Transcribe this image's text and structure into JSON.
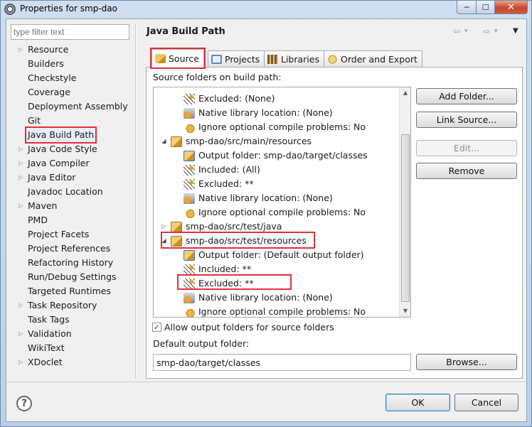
{
  "window": {
    "title": "Properties for smp-dao",
    "minimize": "─",
    "maximize": "☐",
    "close": "✕"
  },
  "filter": {
    "placeholder": "type filter text"
  },
  "nav": {
    "items": [
      {
        "label": "Resource",
        "expandable": true
      },
      {
        "label": "Builders",
        "expandable": false
      },
      {
        "label": "Checkstyle",
        "expandable": false
      },
      {
        "label": "Coverage",
        "expandable": false
      },
      {
        "label": "Deployment Assembly",
        "expandable": false
      },
      {
        "label": "Git",
        "expandable": false
      },
      {
        "label": "Java Build Path",
        "expandable": false,
        "selected": true
      },
      {
        "label": "Java Code Style",
        "expandable": true
      },
      {
        "label": "Java Compiler",
        "expandable": true
      },
      {
        "label": "Java Editor",
        "expandable": true
      },
      {
        "label": "Javadoc Location",
        "expandable": false
      },
      {
        "label": "Maven",
        "expandable": true
      },
      {
        "label": "PMD",
        "expandable": false
      },
      {
        "label": "Project Facets",
        "expandable": false
      },
      {
        "label": "Project References",
        "expandable": false
      },
      {
        "label": "Refactoring History",
        "expandable": false
      },
      {
        "label": "Run/Debug Settings",
        "expandable": false
      },
      {
        "label": "Targeted Runtimes",
        "expandable": false
      },
      {
        "label": "Task Repository",
        "expandable": true
      },
      {
        "label": "Task Tags",
        "expandable": false
      },
      {
        "label": "Validation",
        "expandable": true
      },
      {
        "label": "WikiText",
        "expandable": false
      },
      {
        "label": "XDoclet",
        "expandable": true
      }
    ]
  },
  "page": {
    "title": "Java Build Path",
    "nav_tools": {
      "back": "⇦",
      "back_menu": "▾",
      "forward": "⇨",
      "forward_menu": "▾",
      "menu": "▼"
    }
  },
  "tabs": [
    {
      "label": "Source",
      "icon": "source-folder-icon",
      "active": true
    },
    {
      "label": "Projects",
      "icon": "projects-icon",
      "active": false
    },
    {
      "label": "Libraries",
      "icon": "libraries-icon",
      "active": false
    },
    {
      "label": "Order and Export",
      "icon": "order-export-icon",
      "active": false
    }
  ],
  "source": {
    "section_label": "Source folders on build path:",
    "tree": [
      {
        "level": 1,
        "icon": "filter-icon",
        "label": "Excluded: (None)"
      },
      {
        "level": 1,
        "icon": "native-library-icon",
        "label": "Native library location: (None)"
      },
      {
        "level": 1,
        "icon": "ignore-problems-icon",
        "label": "Ignore optional compile problems: No"
      },
      {
        "level": 0,
        "icon": "source-folder-icon",
        "label": "smp-dao/src/main/resources",
        "expander": "◢"
      },
      {
        "level": 1,
        "icon": "output-folder-icon",
        "label": "Output folder: smp-dao/target/classes"
      },
      {
        "level": 1,
        "icon": "filter-icon",
        "label": "Included: (All)"
      },
      {
        "level": 1,
        "icon": "filter-icon",
        "label": "Excluded: **"
      },
      {
        "level": 1,
        "icon": "native-library-icon",
        "label": "Native library location: (None)"
      },
      {
        "level": 1,
        "icon": "ignore-problems-icon",
        "label": "Ignore optional compile problems: No"
      },
      {
        "level": 0,
        "icon": "source-folder-icon",
        "label": "smp-dao/src/test/java",
        "expander": "▷"
      },
      {
        "level": 0,
        "icon": "source-folder-icon",
        "label": "smp-dao/src/test/resources",
        "expander": "◢"
      },
      {
        "level": 1,
        "icon": "output-folder-icon",
        "label": "Output folder: (Default output folder)"
      },
      {
        "level": 1,
        "icon": "filter-icon",
        "label": "Included: **"
      },
      {
        "level": 1,
        "icon": "filter-icon",
        "label": "Excluded: **"
      },
      {
        "level": 1,
        "icon": "native-library-icon",
        "label": "Native library location: (None)"
      },
      {
        "level": 1,
        "icon": "ignore-problems-icon",
        "label": "Ignore optional compile problems: No"
      }
    ],
    "buttons": {
      "add_folder": "Add Folder...",
      "link_source": "Link Source...",
      "edit": "Edit...",
      "remove": "Remove"
    },
    "allow_output_folders": {
      "label": "Allow output folders for source folders",
      "checked": true,
      "mark": "✓"
    },
    "default_output_label": "Default output folder:",
    "default_output_value": "smp-dao/target/classes",
    "browse": "Browse...",
    "scroll_up": "▲",
    "scroll_down": "▼"
  },
  "footer": {
    "help": "?",
    "ok": "OK",
    "cancel": "Cancel"
  },
  "colors": {
    "highlight": "#e0303b",
    "accent": "#3d72c2"
  }
}
